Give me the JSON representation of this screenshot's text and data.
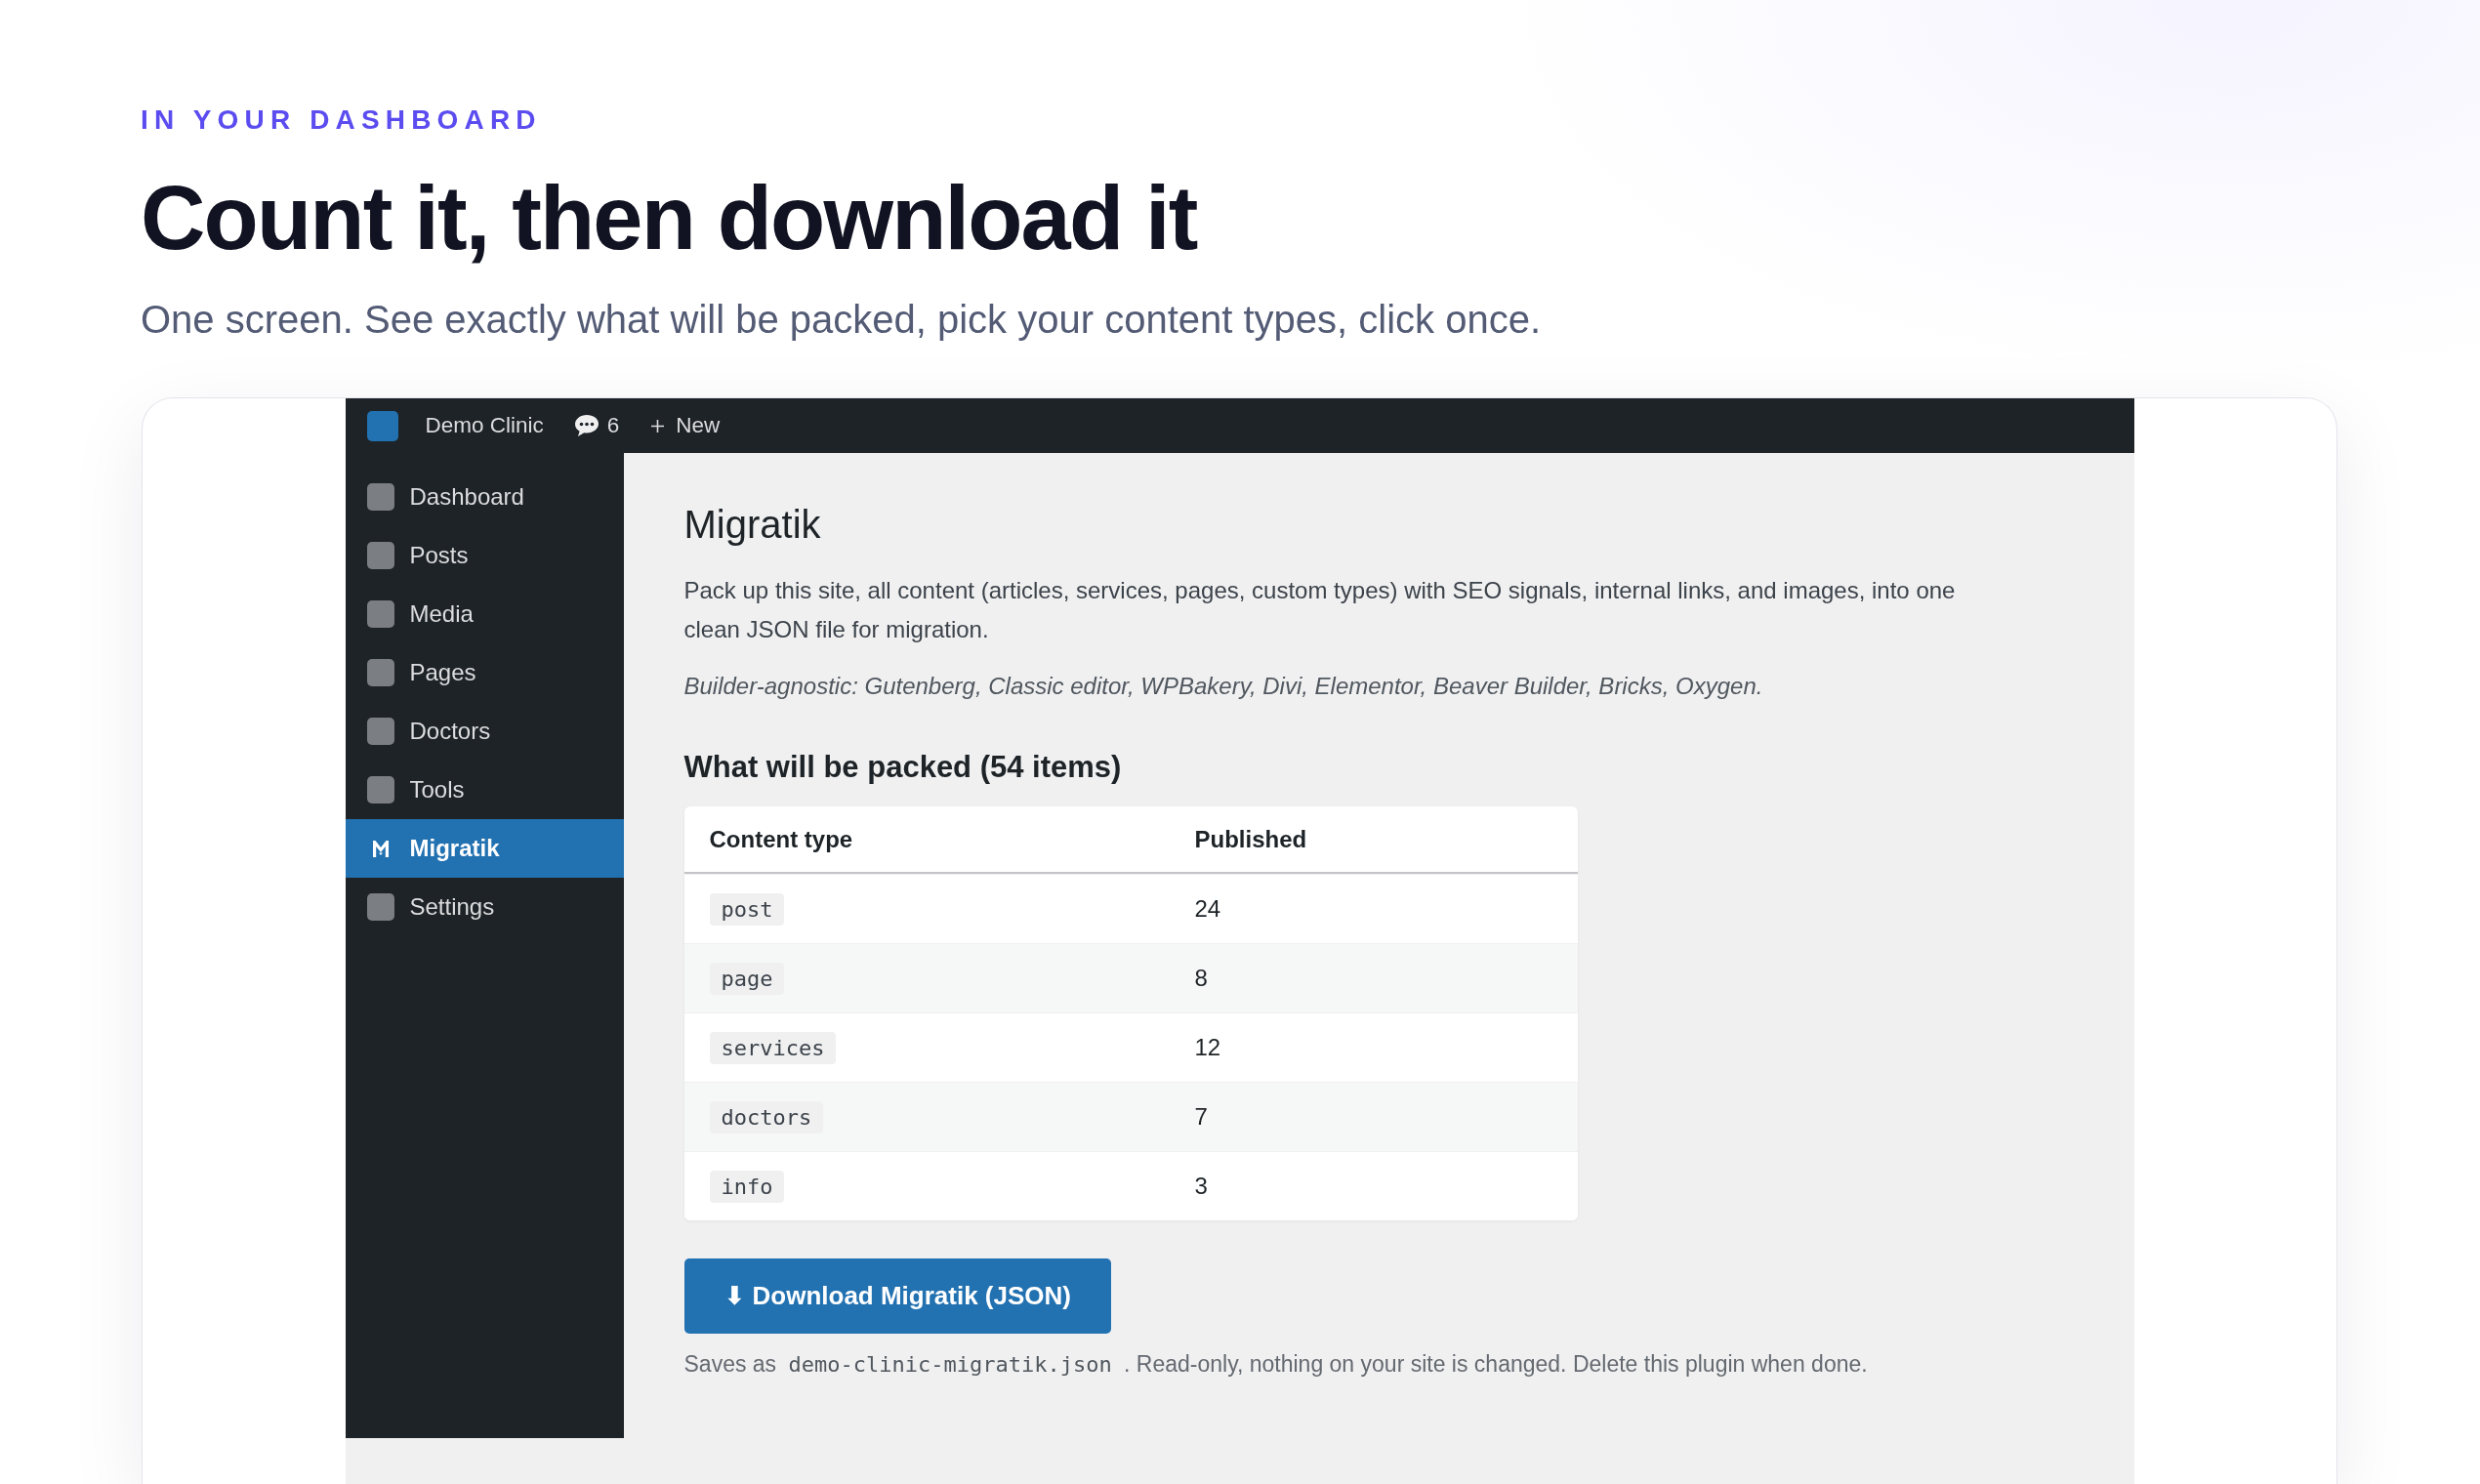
{
  "eyebrow": "IN YOUR DASHBOARD",
  "title": "Count it, then download it",
  "subtitle": "One screen. See exactly what will be packed, pick your content types, click once.",
  "admin": {
    "toolbar": {
      "site_name": "Demo Clinic",
      "comments": "6",
      "new_label": "New"
    },
    "sidebar": {
      "items": [
        {
          "label": "Dashboard",
          "kind": "placeholder",
          "selected": false
        },
        {
          "label": "Posts",
          "kind": "placeholder",
          "selected": false
        },
        {
          "label": "Media",
          "kind": "placeholder",
          "selected": false
        },
        {
          "label": "Pages",
          "kind": "placeholder",
          "selected": false
        },
        {
          "label": "Doctors",
          "kind": "placeholder",
          "selected": false
        },
        {
          "label": "Tools",
          "kind": "placeholder",
          "selected": false
        },
        {
          "label": "Migratik",
          "kind": "plugin",
          "selected": true
        },
        {
          "label": "Settings",
          "kind": "placeholder",
          "selected": false
        }
      ]
    },
    "page": {
      "title": "Migratik",
      "description": "Pack up this site, all content (articles, services, pages, custom types) with SEO signals, internal links, and images, into one clean JSON file for migration.",
      "note": "Builder-agnostic: Gutenberg, Classic editor, WPBakery, Divi, Elementor, Beaver Builder, Bricks, Oxygen.",
      "section_title": "What will be packed (54 items)",
      "table": {
        "columns": [
          "Content type",
          "Published"
        ],
        "rows": [
          {
            "type": "post",
            "published": "24"
          },
          {
            "type": "page",
            "published": "8"
          },
          {
            "type": "services",
            "published": "12"
          },
          {
            "type": "doctors",
            "published": "7"
          },
          {
            "type": "info",
            "published": "3"
          }
        ]
      },
      "download_button": "⬇ Download Migratik (JSON)",
      "file_note": {
        "before": "Saves as",
        "filename": "demo-clinic-migratik.json",
        "after": ". Read-only, nothing on your site is changed. Delete this plugin when done."
      }
    }
  }
}
